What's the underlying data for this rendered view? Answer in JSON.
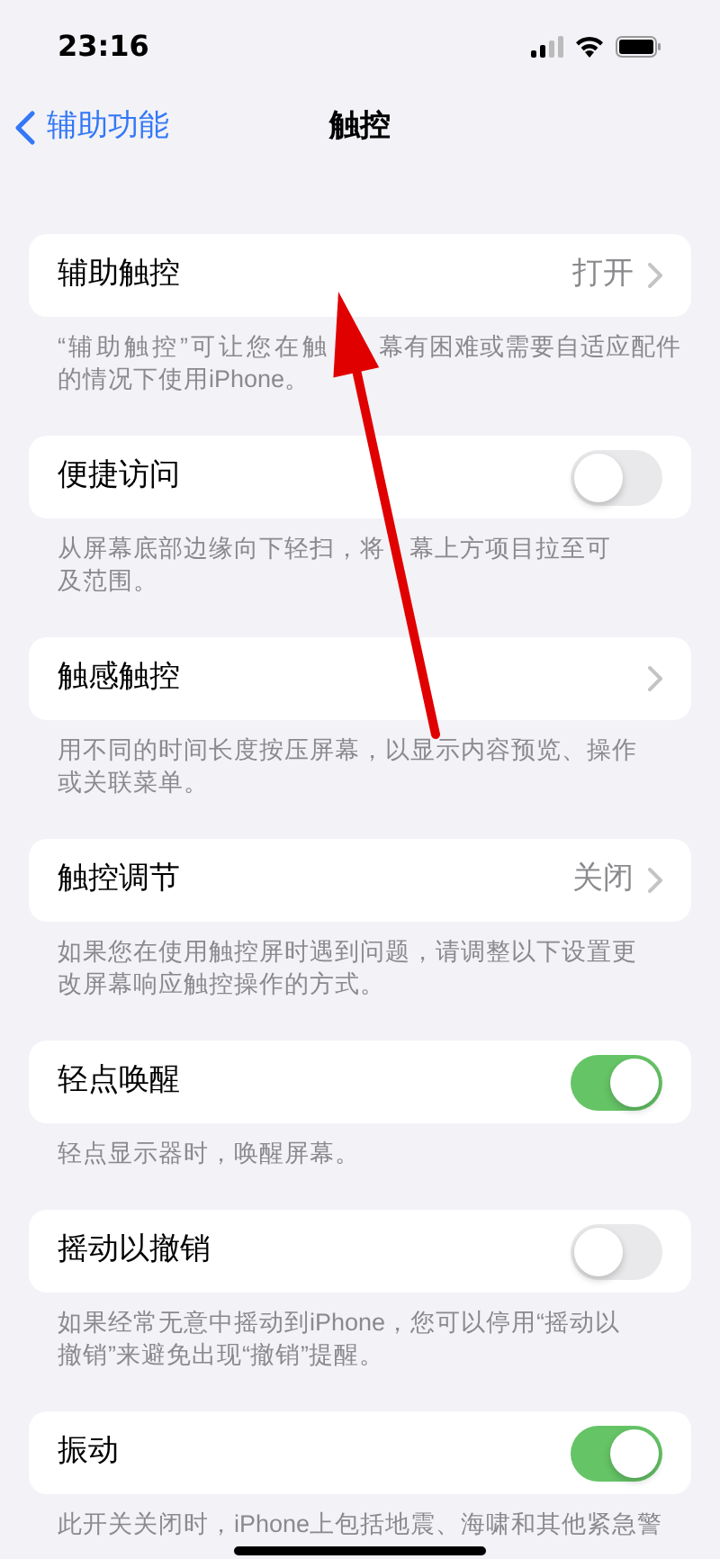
{
  "status_bar": {
    "time": "23:16"
  },
  "nav": {
    "back": "辅助功能",
    "title": "触控"
  },
  "sections": [
    {
      "label": "辅助触控",
      "kind": "link",
      "value": "打开",
      "annotation": {
        "kind": "arrow"
      },
      "footer_parts": [
        "“辅助触控”可让您在触",
        "幕有困难或需要自适应配件",
        "的情况下使用iPhone。"
      ]
    },
    {
      "label": "便捷访问",
      "kind": "toggle",
      "on": false,
      "footer_parts": [
        "从屏幕底部边缘向下轻扫，将",
        "幕上方项目拉至可",
        "及范围。"
      ]
    },
    {
      "label": "触感触控",
      "kind": "link",
      "footer": "用不同的时间长度按压屏幕，以显示内容预览、操作或关联菜单。"
    },
    {
      "label": "触控调节",
      "kind": "link",
      "value": "关闭",
      "footer": "如果您在使用触控屏时遇到问题，请调整以下设置更改屏幕响应触控操作的方式。"
    },
    {
      "label": "轻点唤醒",
      "kind": "toggle",
      "on": true,
      "footer": "轻点显示器时，唤醒屏幕。"
    },
    {
      "label": "摇动以撤销",
      "kind": "toggle",
      "on": false,
      "footer": "如果经常无意中摇动到iPhone，您可以停用“摇动以撤销”来避免出现“撤销”提醒。"
    },
    {
      "label": "振动",
      "kind": "toggle",
      "on": true,
      "footer": "此开关关闭时，iPhone上包括地震、海啸和其他紧急警",
      "footer_cut": true
    }
  ]
}
